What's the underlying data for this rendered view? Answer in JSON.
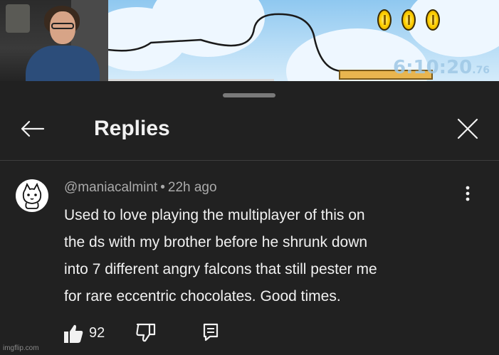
{
  "video": {
    "timer_main": "6:10:20",
    "timer_fraction": ".76",
    "coin_count_shown": 3,
    "progress_fraction": 0.55
  },
  "header": {
    "title": "Replies",
    "back_icon": "arrow-left-icon",
    "close_icon": "close-icon"
  },
  "comment": {
    "author": "@maniacalmint",
    "separator": "•",
    "age": "22h ago",
    "lines": [
      "Used to love playing the multiplayer of this on",
      "the ds with my brother before he shrunk down",
      "into 7 different angry falcons that still pester me",
      "for rare eccentric chocolates. Good times."
    ],
    "like_count": "92",
    "more_icon": "more-vertical-icon"
  },
  "watermark": "imgflip.com",
  "colors": {
    "background": "#212121",
    "text_primary": "#f1f1f1",
    "text_secondary": "#aaaaaa",
    "divider": "#3d3d3d"
  }
}
